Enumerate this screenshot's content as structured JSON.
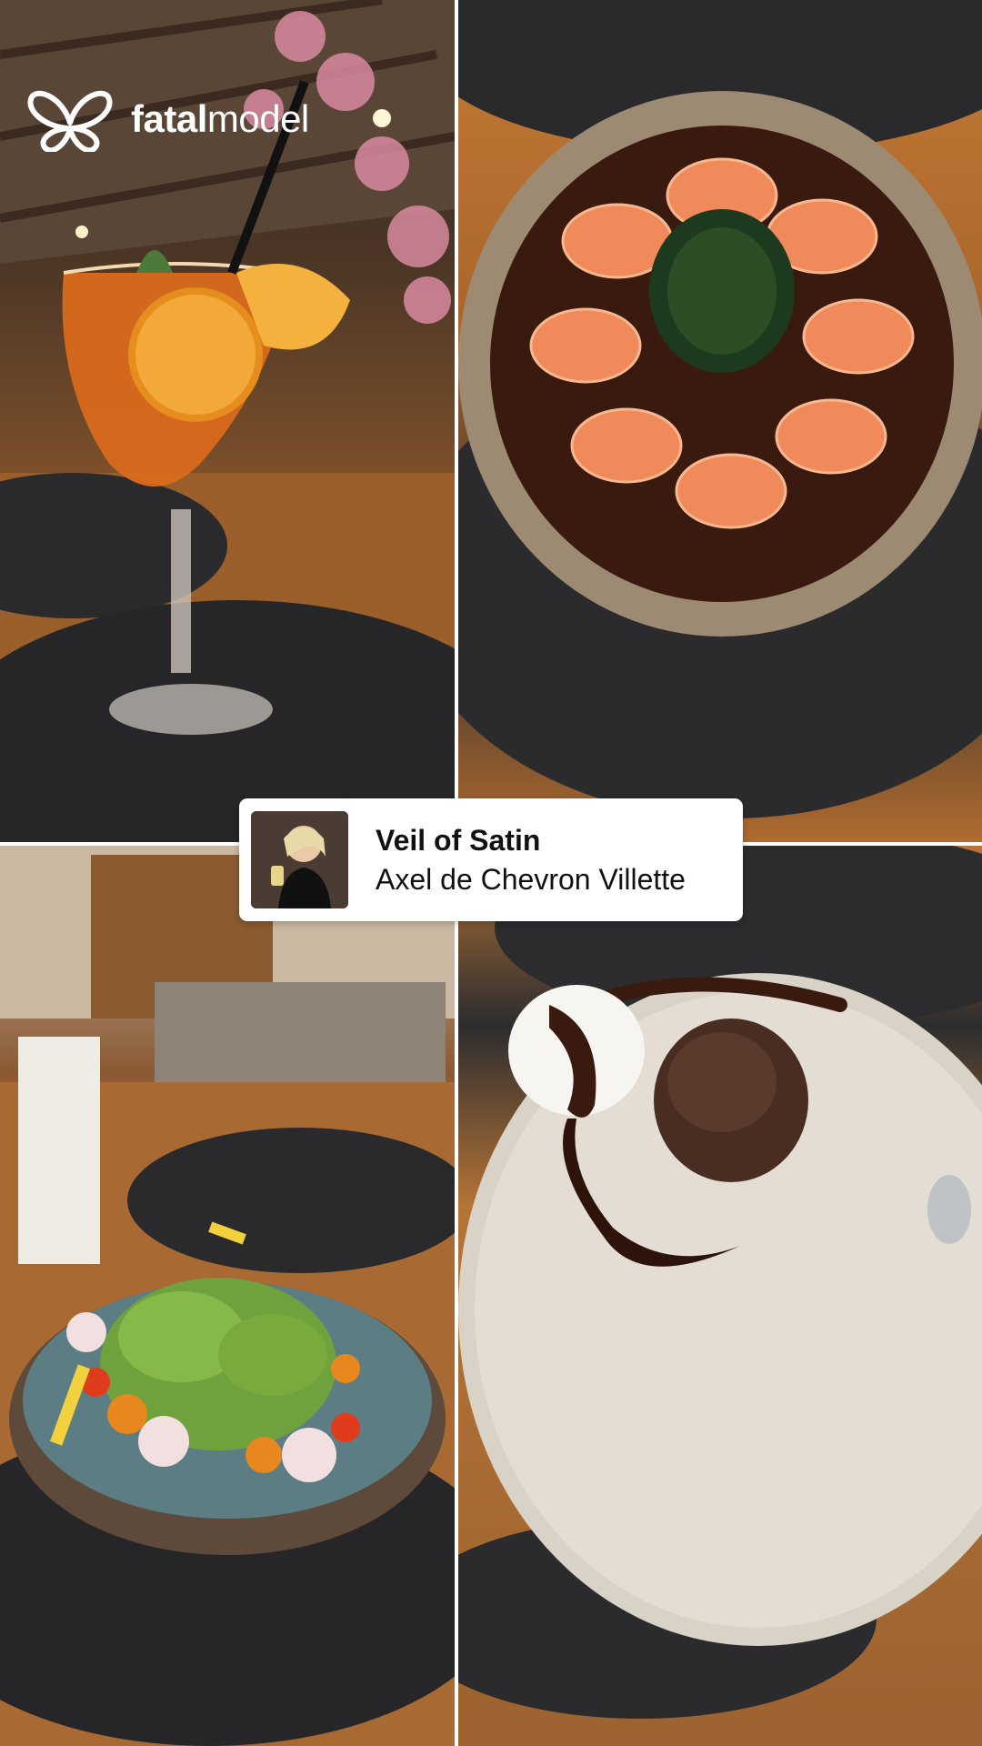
{
  "brand": {
    "logo_text_bold": "fatal",
    "logo_text_regular": "model",
    "logo_icon": "butterfly-icon"
  },
  "music_card": {
    "title": "Veil of Satin",
    "artist": "Axel de Chevron Villette",
    "cover_icon": "album-cover"
  },
  "photos": [
    {
      "name": "photo-cocktail",
      "subject": "cocktail"
    },
    {
      "name": "photo-salmon",
      "subject": "salmon"
    },
    {
      "name": "photo-salad",
      "subject": "salad"
    },
    {
      "name": "photo-dessert",
      "subject": "dessert"
    }
  ],
  "colors": {
    "card_background": "#ffffff",
    "text_primary": "#111111",
    "logo_color": "#ffffff"
  }
}
